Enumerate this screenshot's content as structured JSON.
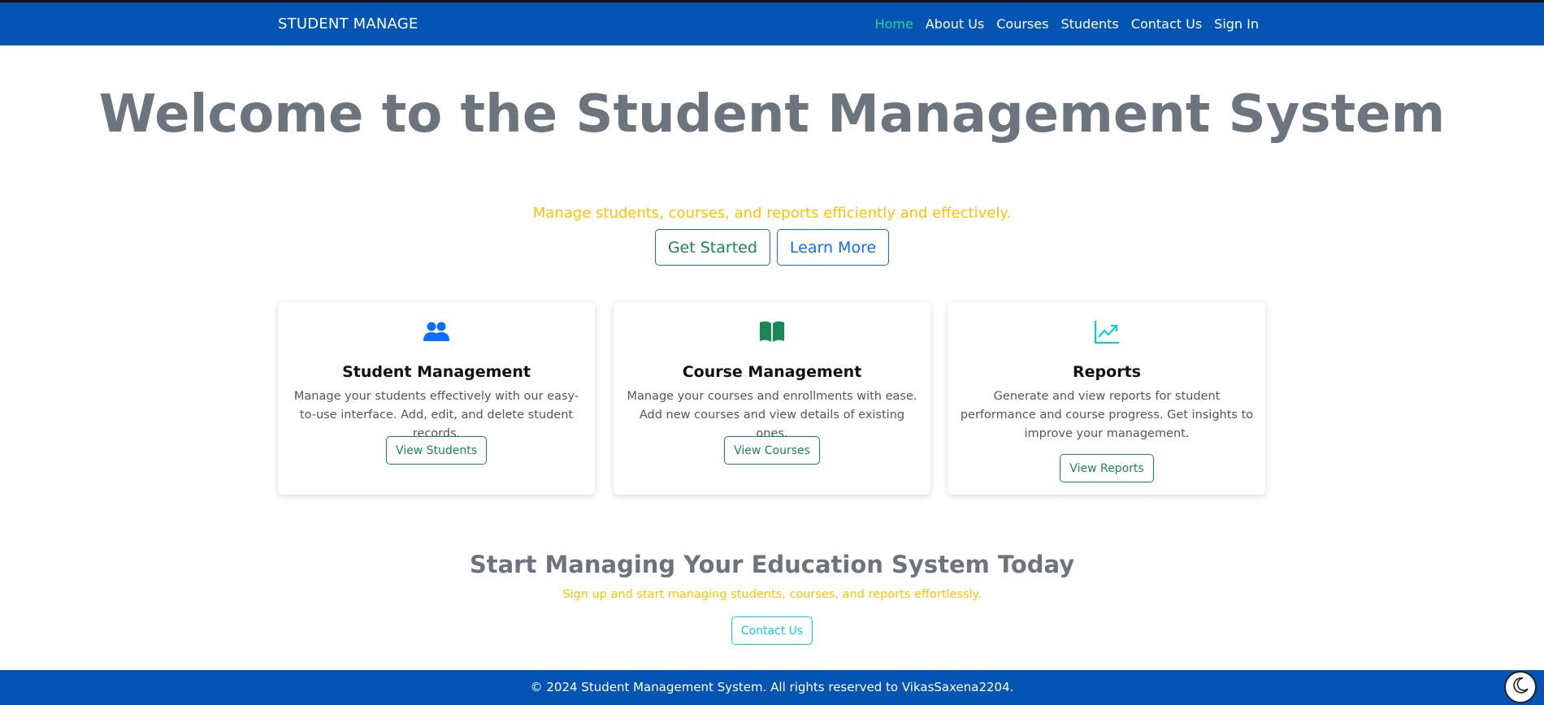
{
  "navbar": {
    "brand": "STUDENT MANAGE",
    "items": [
      {
        "label": "Home",
        "active": true
      },
      {
        "label": "About Us"
      },
      {
        "label": "Courses"
      },
      {
        "label": "Students"
      },
      {
        "label": "Contact Us"
      },
      {
        "label": "Sign In"
      }
    ]
  },
  "hero": {
    "title": "Welcome to the Student Management System",
    "subtitle": "Manage students, courses, and reports efficiently and effectively.",
    "primary_button": "Get Started",
    "secondary_button": "Learn More"
  },
  "cards": [
    {
      "icon": "users-icon",
      "title": "Student Management",
      "text": "Manage your students effectively with our easy-to-use interface. Add, edit, and delete student records.",
      "button": "View Students"
    },
    {
      "icon": "book-icon",
      "title": "Course Management",
      "text": "Manage your courses and enrollments with ease. Add new courses and view details of existing ones.",
      "button": "View Courses"
    },
    {
      "icon": "chart-line-icon",
      "title": "Reports",
      "text": "Generate and view reports for student performance and course progress. Get insights to improve your management.",
      "button": "View Reports"
    }
  ],
  "cta": {
    "title": "Start Managing Your Education System Today",
    "subtitle": "Sign up and start managing students, courses, and reports effortlessly.",
    "button": "Contact Us"
  },
  "footer": {
    "text": "© 2024 Student Management System. All rights reserved to VikasSaxena2204."
  },
  "theme_toggle": {
    "icon": "moon-icon"
  },
  "colors": {
    "navbar": "#0454b4",
    "active_link": "#2fd18a",
    "title_gray": "#6c757d",
    "subtitle_yellow": "#ffc107",
    "green": "#198754",
    "blue": "#0d6efd",
    "teal": "#0dcaf0"
  }
}
